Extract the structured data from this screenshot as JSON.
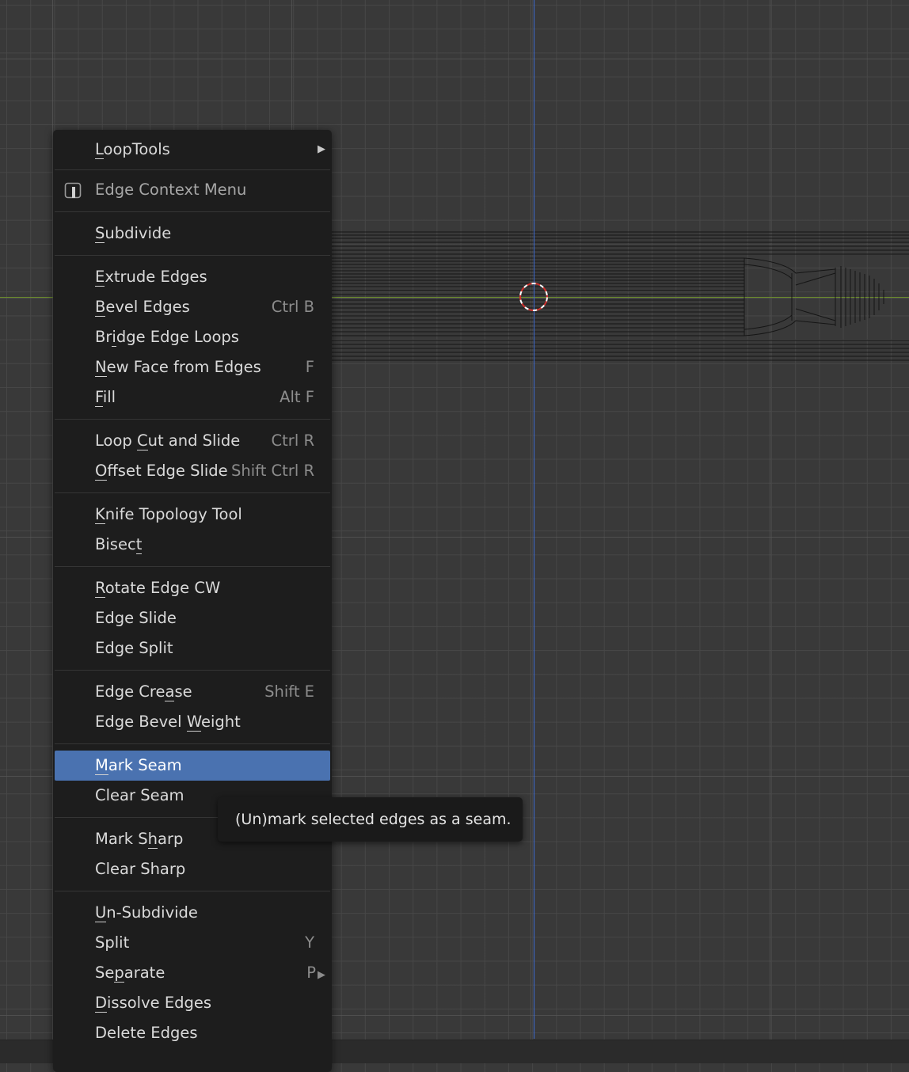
{
  "menu": {
    "title": "Edge Context Menu",
    "looptools": {
      "pre": "",
      "u": "L",
      "post": "oopTools"
    },
    "groups": [
      [
        {
          "pre": "",
          "u": "S",
          "post": "ubdivide",
          "shortcut": ""
        }
      ],
      [
        {
          "pre": "",
          "u": "E",
          "post": "xtrude Edges",
          "shortcut": ""
        },
        {
          "pre": "",
          "u": "B",
          "post": "evel Edges",
          "shortcut": "Ctrl B"
        },
        {
          "pre": "Br",
          "u": "i",
          "post": "dge Edge Loops",
          "shortcut": ""
        },
        {
          "pre": "",
          "u": "N",
          "post": "ew Face from Edges",
          "shortcut": "F"
        },
        {
          "pre": "",
          "u": "F",
          "post": "ill",
          "shortcut": "Alt F"
        }
      ],
      [
        {
          "pre": "Loop ",
          "u": "C",
          "post": "ut and Slide",
          "shortcut": "Ctrl R"
        },
        {
          "pre": "",
          "u": "O",
          "post": "ffset Edge Slide",
          "shortcut": "Shift Ctrl R"
        }
      ],
      [
        {
          "pre": "",
          "u": "K",
          "post": "nife Topology Tool",
          "shortcut": ""
        },
        {
          "pre": "Bisec",
          "u": "t",
          "post": "",
          "shortcut": ""
        }
      ],
      [
        {
          "pre": "",
          "u": "R",
          "post": "otate Edge CW",
          "shortcut": ""
        },
        {
          "pre": "Edge Slide",
          "u": "",
          "post": "",
          "shortcut": ""
        },
        {
          "pre": "Edge Split",
          "u": "",
          "post": "",
          "shortcut": ""
        }
      ],
      [
        {
          "pre": "Edge Cre",
          "u": "a",
          "post": "se",
          "shortcut": "Shift E"
        },
        {
          "pre": "Edge Bevel ",
          "u": "W",
          "post": "eight",
          "shortcut": ""
        }
      ],
      [
        {
          "pre": "",
          "u": "M",
          "post": "ark Seam",
          "shortcut": "",
          "active": true
        },
        {
          "pre": "Clear Seam",
          "u": "",
          "post": "",
          "shortcut": ""
        }
      ],
      [
        {
          "pre": "Mark S",
          "u": "h",
          "post": "arp",
          "shortcut": ""
        },
        {
          "pre": "Clear Sharp",
          "u": "",
          "post": "",
          "shortcut": ""
        }
      ],
      [
        {
          "pre": "",
          "u": "U",
          "post": "n-Subdivide",
          "shortcut": ""
        },
        {
          "pre": "Split",
          "u": "",
          "post": "",
          "shortcut": "Y"
        },
        {
          "pre": "Se",
          "u": "p",
          "post": "arate",
          "shortcut": "P",
          "submenu": true
        },
        {
          "pre": "",
          "u": "D",
          "post": "issolve Edges",
          "shortcut": ""
        },
        {
          "pre": "Delete Edges",
          "u": "",
          "post": "",
          "shortcut": ""
        }
      ]
    ]
  },
  "tooltip": {
    "text": "(Un)mark selected edges as a seam."
  },
  "colors": {
    "highlight": "#4a72b0",
    "menu_bg": "#1d1d1d",
    "viewport_bg": "#393939",
    "z_axis": "#3e6bd0",
    "x_axis": "#6b8d2a"
  }
}
